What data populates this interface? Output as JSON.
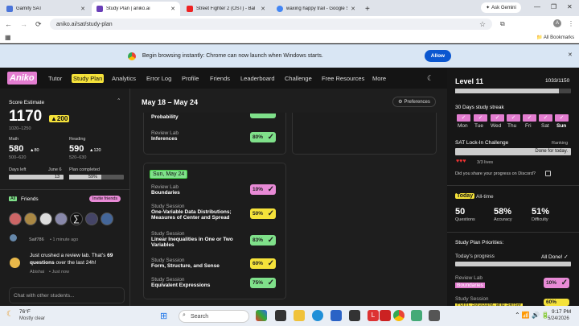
{
  "browser": {
    "tabs": [
      {
        "title": "Gamify SAT",
        "color": "#4a74d9"
      },
      {
        "title": "Study Plan | aniko.ai",
        "color": "#6a3fb8"
      },
      {
        "title": "Street Fighter 2 (OST) - Bal",
        "color": "#e22"
      },
      {
        "title": "waxing happy trail - Google Se",
        "color": "#4285f4"
      }
    ],
    "ask": "Ask Gemini",
    "url": "aniko.ai/sat/study-plan",
    "bookmarks": "All Bookmarks",
    "info_text": "Begin browsing instantly: Chrome can now launch when Windows starts.",
    "info_button": "Allow"
  },
  "app": {
    "logo": "Aniko",
    "nav": [
      "Tutor",
      "Study Plan",
      "Analytics",
      "Error Log",
      "Profile",
      "Friends",
      "Leaderboard",
      "Challenge",
      "Free Resources",
      "More"
    ]
  },
  "left": {
    "score_label": "Score Estimate",
    "score": "1170",
    "score_delta": "▲200",
    "score_range": "1020–1250",
    "math_label": "Math",
    "math": "580",
    "math_delta": "▲80",
    "math_range": "500–620",
    "reading_label": "Reading",
    "reading": "590",
    "reading_delta": "▲120",
    "reading_range": "520–630",
    "days_left": "Days left",
    "days_date": "June 6",
    "days_value": "13",
    "plan_label": "Plan completed",
    "plan_value": "59%",
    "plan_fraction": 0.59,
    "friends_badge": "All",
    "friends_label": "Friends",
    "invite": "Invite friends",
    "feed1_user": "Saif786",
    "feed1_time": "• 1 minute ago",
    "feed2_text_a": "Just crushed a review lab. That's ",
    "feed2_text_b": "69 questions",
    "feed2_text_c": " over the last 24h!",
    "feed2_user": "Abishai",
    "feed2_time": "• Just now",
    "chat_placeholder": "Chat with other students..."
  },
  "mid": {
    "range": "May 18 – May 24",
    "prefs": "Preferences",
    "top_items": [
      {
        "t1": "",
        "t2": "Probability",
        "score": "",
        "color": "grn"
      },
      {
        "t1": "Review Lab",
        "t2": "Inferences",
        "score": "80%",
        "color": "grn"
      }
    ],
    "day_label": "Sun, May 24",
    "items": [
      {
        "t1": "Review Lab",
        "t2": "Boundaries",
        "score": "10%",
        "color": "pink"
      },
      {
        "t1": "Study Session",
        "t2": "One-Variable Data Distributions; Measures of Center and Spread",
        "score": "50%",
        "color": "yel"
      },
      {
        "t1": "Study Session",
        "t2": "Linear Inequalities in One or Two Variables",
        "score": "83%",
        "color": "grn"
      },
      {
        "t1": "Study Session",
        "t2": "Form, Structure, and Sense",
        "score": "60%",
        "color": "yel"
      },
      {
        "t1": "Study Session",
        "t2": "Equivalent Expressions",
        "score": "75%",
        "color": "grn"
      }
    ]
  },
  "right": {
    "level": "Level 11",
    "xp": "1033/1150",
    "xp_fraction": 0.898,
    "streak_label": "30 Days study streak",
    "days": [
      "Mon",
      "Tue",
      "Wed",
      "Thu",
      "Fri",
      "Sat",
      "Sun"
    ],
    "challenge": "SAT Lock-In Challenge",
    "ranking": "Ranking",
    "done": "Done for today.",
    "lives": "3/3 lives",
    "discord": "Did you share your progress on Discord?",
    "today": "Today",
    "alltime": "All-time",
    "q": "50",
    "q_label": "Questions",
    "acc": "58%",
    "acc_label": "Accuracy",
    "diff": "51%",
    "diff_label": "Difficulty",
    "priorities": "Study Plan Priorities:",
    "progress": "Today's progress",
    "all_done": "All Done!",
    "p1_t1": "Review Lab",
    "p1_t2": "Boundaries",
    "p1_score": "10%",
    "p2_t1": "Study Session",
    "p2_t2": "Form, Structure, and Sense",
    "p2_score": "60%"
  },
  "taskbar": {
    "temp": "76°F",
    "weather": "Mostly clear",
    "search": "Search",
    "time": "9:17 PM",
    "date": "5/24/2026"
  }
}
